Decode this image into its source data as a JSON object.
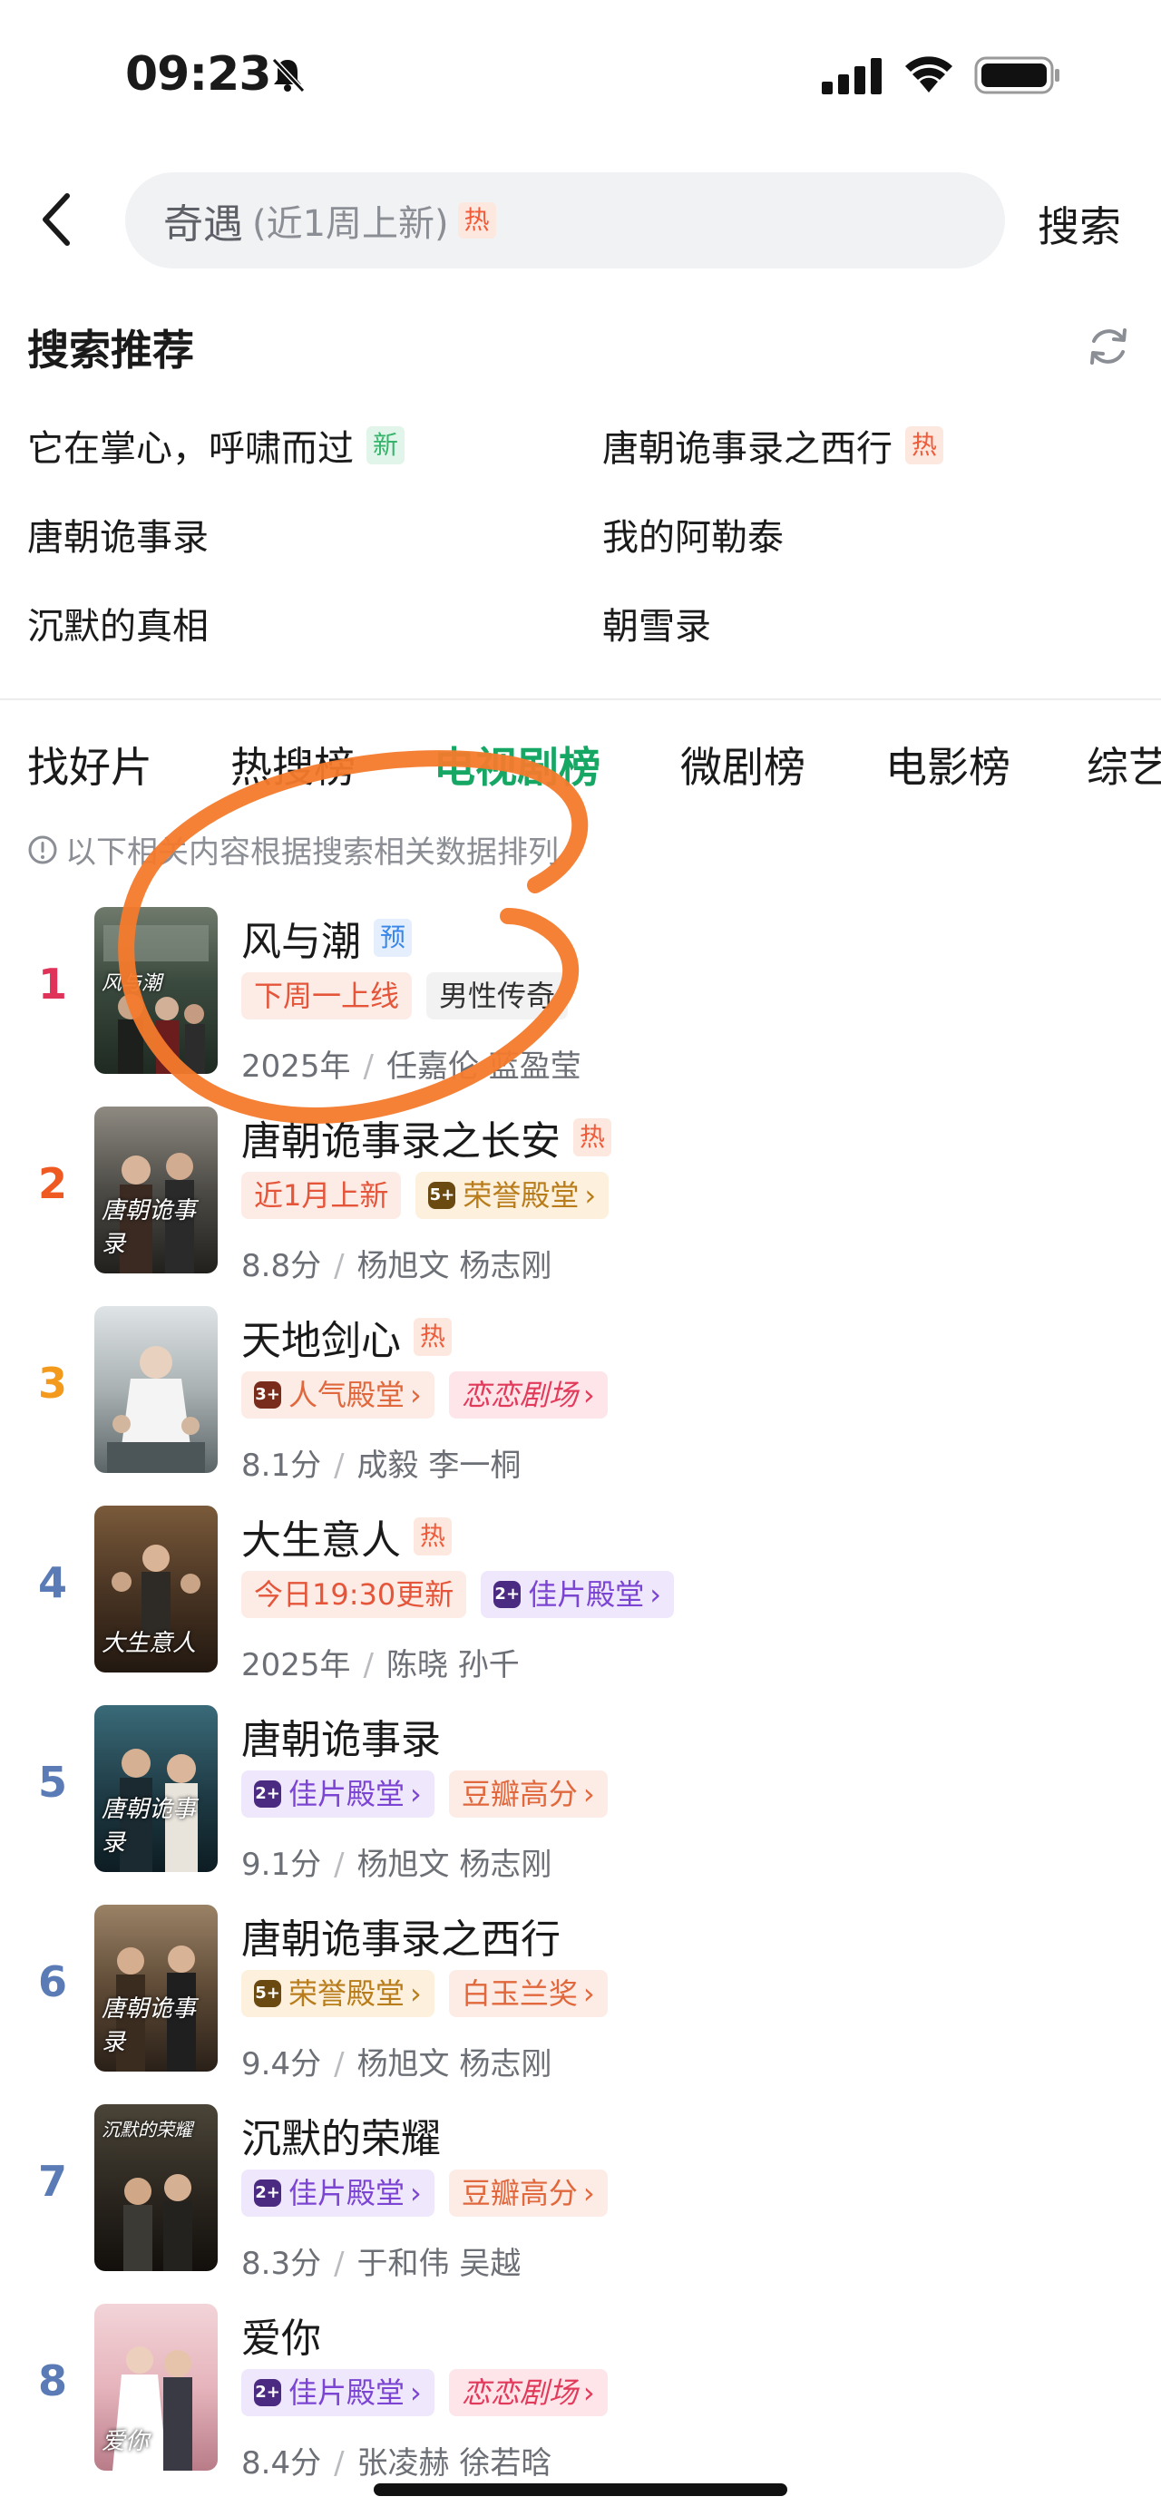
{
  "status_bar": {
    "time": "09:23"
  },
  "search": {
    "query": "奇遇",
    "hint": "(近1周上新)",
    "hot_tag": "热",
    "button_label": "搜索"
  },
  "recommend": {
    "title": "搜索推荐",
    "items": [
      {
        "label": "它在掌心，呼啸而过",
        "tag": "新"
      },
      {
        "label": "唐朝诡事录之西行",
        "tag": "热"
      },
      {
        "label": "唐朝诡事录",
        "tag": ""
      },
      {
        "label": "我的阿勒泰",
        "tag": ""
      },
      {
        "label": "沉默的真相",
        "tag": ""
      },
      {
        "label": "朝雪录",
        "tag": ""
      }
    ]
  },
  "tabs": [
    {
      "label": "找好片",
      "active": false
    },
    {
      "label": "热搜榜",
      "active": false
    },
    {
      "label": "电视剧榜",
      "active": true
    },
    {
      "label": "微剧榜",
      "active": false
    },
    {
      "label": "电影榜",
      "active": false
    },
    {
      "label": "综艺",
      "active": false
    }
  ],
  "notice": "以下相关内容根据搜索相关数据排列",
  "list": [
    {
      "rank": "1",
      "title": "风与潮",
      "title_tag": "预",
      "tags": [
        "下周一上线",
        "男性传奇"
      ],
      "meta_left": "2025年",
      "meta_right": "任嘉伦 蓝盈莹"
    },
    {
      "rank": "2",
      "title": "唐朝诡事录之长安",
      "title_tag": "热",
      "tags": [
        "近1月上新",
        "荣誉殿堂"
      ],
      "meta_left": "8.8分",
      "meta_right": "杨旭文 杨志刚"
    },
    {
      "rank": "3",
      "title": "天地剑心",
      "title_tag": "热",
      "tags": [
        "人气殿堂",
        "恋恋剧场"
      ],
      "meta_left": "8.1分",
      "meta_right": "成毅 李一桐"
    },
    {
      "rank": "4",
      "title": "大生意人",
      "title_tag": "热",
      "tags": [
        "今日19:30更新",
        "佳片殿堂"
      ],
      "meta_left": "2025年",
      "meta_right": "陈晓 孙千"
    },
    {
      "rank": "5",
      "title": "唐朝诡事录",
      "title_tag": "",
      "tags": [
        "佳片殿堂",
        "豆瓣高分"
      ],
      "meta_left": "9.1分",
      "meta_right": "杨旭文 杨志刚"
    },
    {
      "rank": "6",
      "title": "唐朝诡事录之西行",
      "title_tag": "",
      "tags": [
        "荣誉殿堂",
        "白玉兰奖"
      ],
      "meta_left": "9.4分",
      "meta_right": "杨旭文 杨志刚"
    },
    {
      "rank": "7",
      "title": "沉默的荣耀",
      "title_tag": "",
      "tags": [
        "佳片殿堂",
        "豆瓣高分"
      ],
      "meta_left": "8.3分",
      "meta_right": "于和伟 吴越"
    },
    {
      "rank": "8",
      "title": "爱你",
      "title_tag": "",
      "tags": [
        "佳片殿堂",
        "恋恋剧场"
      ],
      "meta_left": "8.4分",
      "meta_right": "张凌赫 徐若晗"
    }
  ],
  "posters": {
    "p1": "风与潮",
    "p2": "唐朝诡事录",
    "p4": "大生意人",
    "p5": "唐朝诡事录",
    "p6": "唐朝诡事录",
    "p7": "沉默的荣耀",
    "p8": "爱你"
  },
  "badges": {
    "honor": "5+",
    "popular": "3+",
    "quality": "2+"
  },
  "colors": {
    "accent_green": "#16a765",
    "rank1": "#e0335a",
    "rank2": "#ef5a23",
    "rank3": "#f39a1d",
    "rank_other": "#5a7bb5",
    "annotation_orange": "#f47a2c"
  }
}
